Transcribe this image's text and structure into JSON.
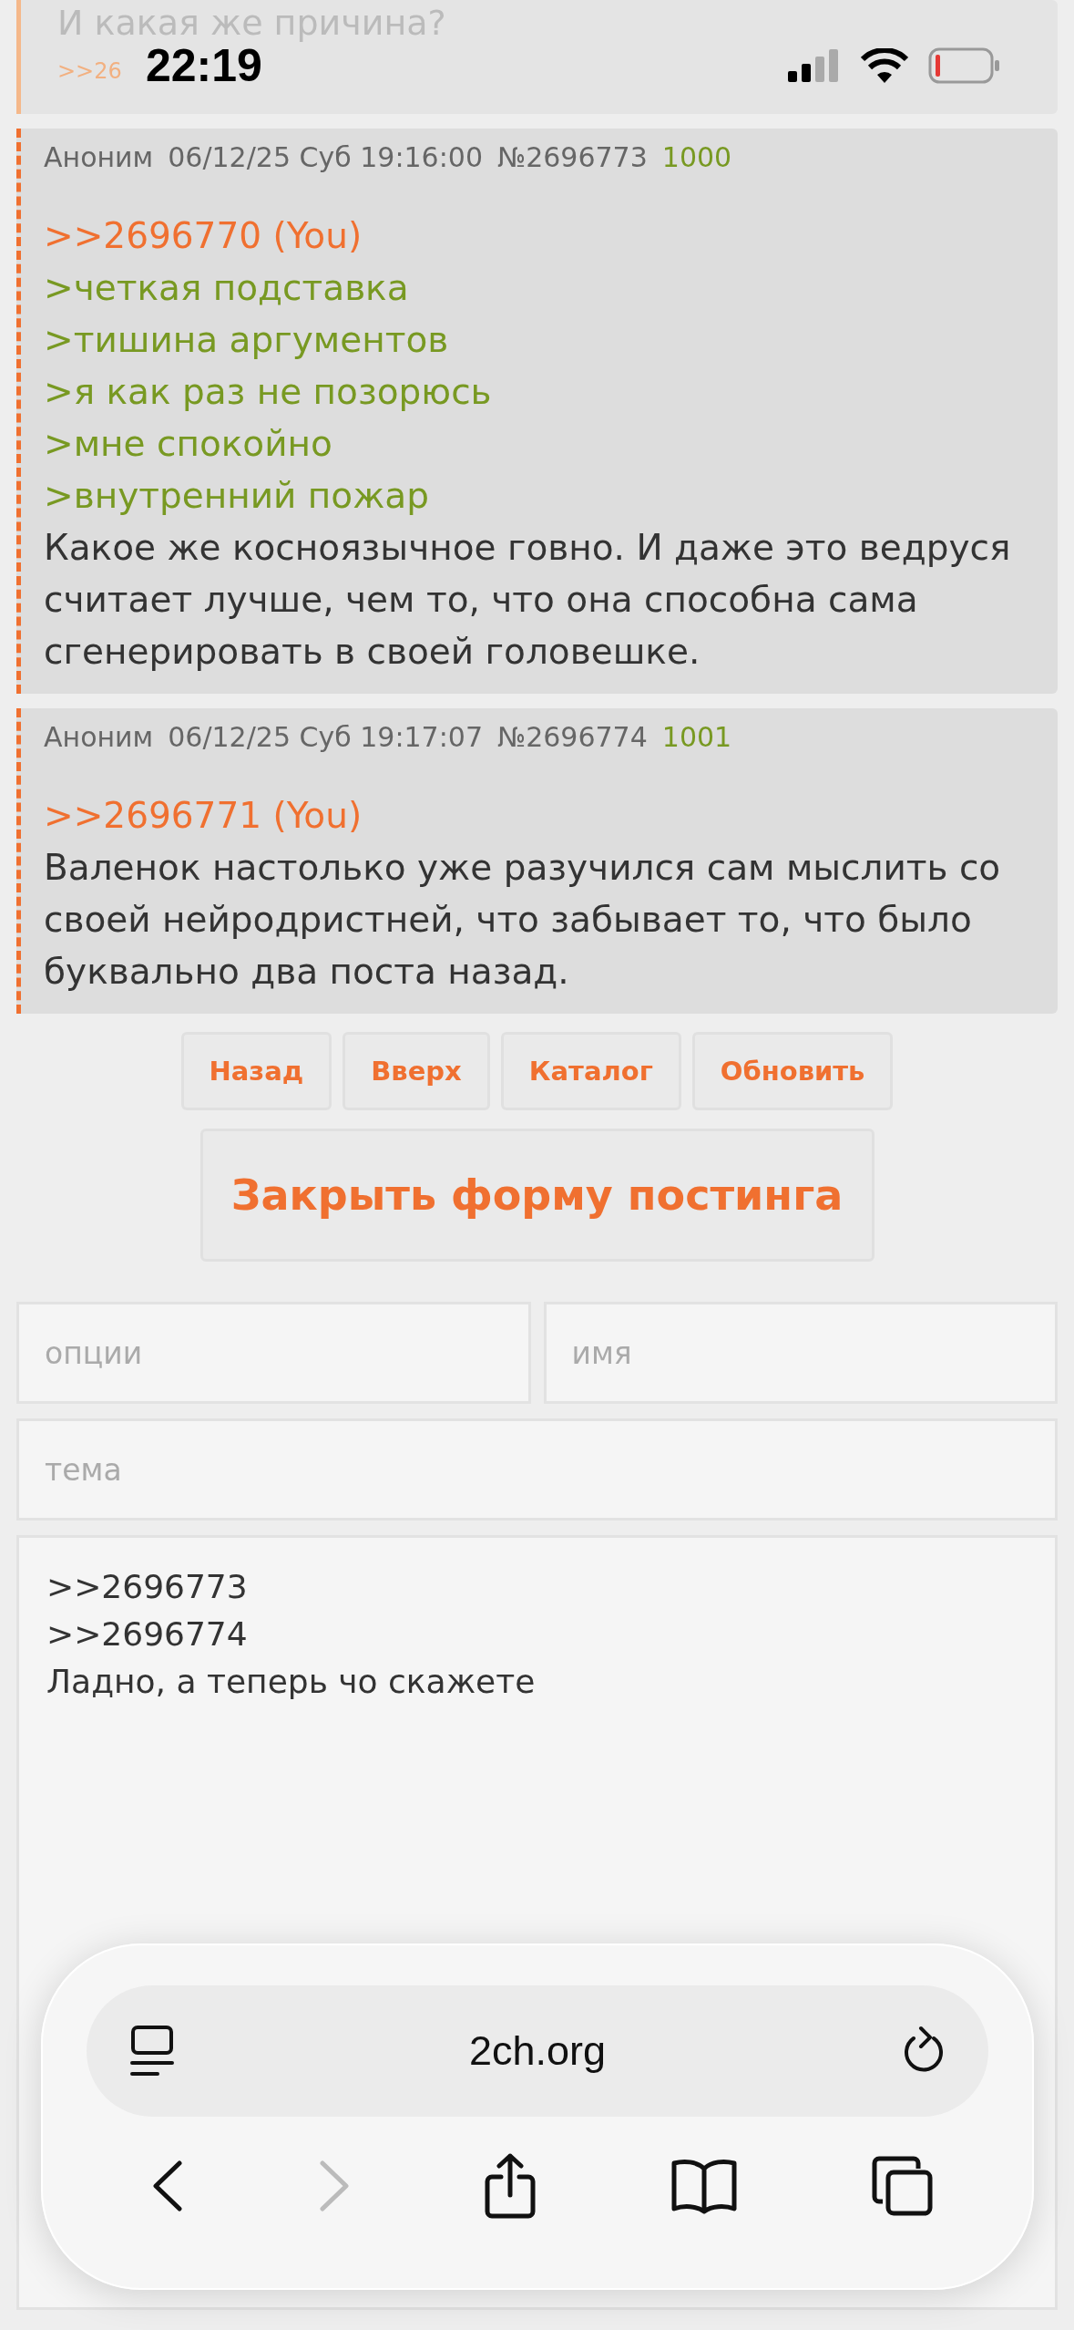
{
  "status_bar": {
    "time": "22:19",
    "battery_low": true
  },
  "partial_post": {
    "text": "И какая же причина?",
    "reply_link": ">>26"
  },
  "posts": [
    {
      "author": "Аноним",
      "date": "06/12/25 Суб 19:16:00",
      "number": "№2696773",
      "index": "1000",
      "lines": [
        {
          "kind": "reply",
          "text": ">>2696770 (You)"
        },
        {
          "kind": "quote",
          "text": ">четкая подставка"
        },
        {
          "kind": "quote",
          "text": ">тишина аргументов"
        },
        {
          "kind": "quote",
          "text": ">я как раз не позорюсь"
        },
        {
          "kind": "quote",
          "text": ">мне спокойно"
        },
        {
          "kind": "quote",
          "text": ">внутренний пожар"
        },
        {
          "kind": "plain",
          "text": "Какое же косноязычное говно. И даже это ведруся считает лучше, чем то, что она способна сама сгенерировать в своей головешке."
        }
      ]
    },
    {
      "author": "Аноним",
      "date": "06/12/25 Суб 19:17:07",
      "number": "№2696774",
      "index": "1001",
      "lines": [
        {
          "kind": "reply",
          "text": ">>2696771 (You)"
        },
        {
          "kind": "plain",
          "text": "Валенок настолько уже разучился сам мыслить со своей нейродристней, что забывает то, что было буквально два поста назад."
        }
      ]
    }
  ],
  "nav_buttons": [
    "Назад",
    "Вверх",
    "Каталог",
    "Обновить"
  ],
  "close_form_button": "Закрыть форму постинга",
  "form": {
    "options_placeholder": "опции",
    "name_placeholder": "имя",
    "subject_placeholder": "тема",
    "message": ">>2696773\n>>2696774\nЛадно, а теперь чо скажете"
  },
  "browser": {
    "url": "2ch.org",
    "forward_disabled": true
  }
}
